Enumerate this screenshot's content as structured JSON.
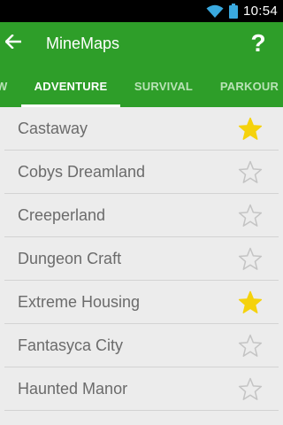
{
  "status_bar": {
    "time": "10:54",
    "icons": [
      "wifi-icon",
      "battery-icon"
    ]
  },
  "app_bar": {
    "back_icon": "arrow-left-icon",
    "title": "MineMaps",
    "help_label": "?"
  },
  "tabs": [
    {
      "label": "W",
      "active": false
    },
    {
      "label": "ADVENTURE",
      "active": true
    },
    {
      "label": "SURVIVAL",
      "active": false
    },
    {
      "label": "PARKOUR",
      "active": false
    }
  ],
  "maps": [
    {
      "name": "Castaway",
      "favorite": true
    },
    {
      "name": "Cobys Dreamland",
      "favorite": false
    },
    {
      "name": "Creeperland",
      "favorite": false
    },
    {
      "name": "Dungeon Craft",
      "favorite": false
    },
    {
      "name": "Extreme Housing",
      "favorite": true
    },
    {
      "name": "Fantasyca City",
      "favorite": false
    },
    {
      "name": "Haunted Manor",
      "favorite": false
    }
  ],
  "colors": {
    "primary": "#2e9e29",
    "star_filled": "#f5d20c",
    "star_outline": "#c4c4c4",
    "item_text": "#6b6b6b"
  }
}
